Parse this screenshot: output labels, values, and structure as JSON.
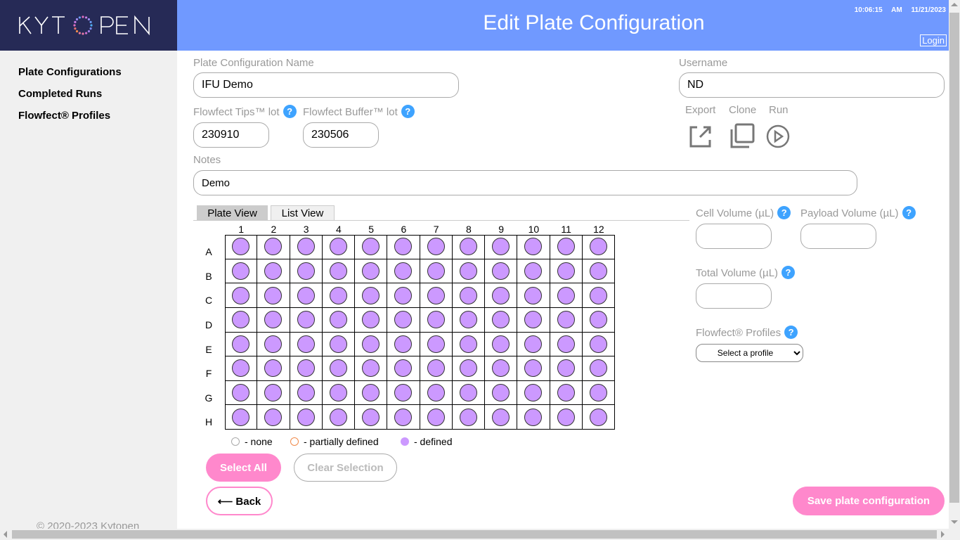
{
  "logo": {
    "text": "KYTOPEN"
  },
  "header": {
    "title": "Edit Plate Configuration",
    "time": "10:06:15 AM",
    "date": "11/21/2023",
    "login": "Login"
  },
  "sidebar": {
    "items": [
      {
        "label": "Plate Configurations"
      },
      {
        "label": "Completed Runs"
      },
      {
        "label": "Flowfect® Profiles"
      }
    ],
    "copyright": "© 2020-2023 Kytopen"
  },
  "form": {
    "name_label": "Plate Configuration Name",
    "name_value": "IFU Demo",
    "username_label": "Username",
    "username_value": "ND",
    "tips_label": "Flowfect Tips™ lot",
    "tips_value": "230910",
    "buffer_label": "Flowfect Buffer™ lot",
    "buffer_value": "230506",
    "notes_label": "Notes",
    "notes_value": "Demo",
    "help": "?"
  },
  "actions": {
    "export": "Export",
    "clone": "Clone",
    "run": "Run"
  },
  "tabs": [
    {
      "label": "Plate View",
      "active": true
    },
    {
      "label": "List View",
      "active": false
    }
  ],
  "plate": {
    "columns": [
      "1",
      "2",
      "3",
      "4",
      "5",
      "6",
      "7",
      "8",
      "9",
      "10",
      "11",
      "12"
    ],
    "rows": [
      "A",
      "B",
      "C",
      "D",
      "E",
      "F",
      "G",
      "H"
    ],
    "well_state": "defined",
    "defined_color": "#cc99ff"
  },
  "legend": [
    {
      "label": "- none",
      "color": "#ffffff",
      "border": "#aaaaaa"
    },
    {
      "label": "- partially defined",
      "color": "#ffffff",
      "border": "#f08a4b"
    },
    {
      "label": "- defined",
      "color": "#cc99ff",
      "border": "#cc99ff"
    }
  ],
  "volumes": {
    "cell_label": "Cell Volume (µL)",
    "cell_value": "",
    "payload_label": "Payload Volume (µL)",
    "payload_value": "",
    "total_label": "Total Volume (µL)",
    "total_value": "",
    "profiles_label": "Flowfect® Profiles",
    "profile_select": "Select a profile"
  },
  "buttons": {
    "select_all": "Select All",
    "clear_selection": "Clear Selection",
    "back": "⟵ Back",
    "save": "Save plate configuration"
  },
  "colors": {
    "header": "#7099ff",
    "logo_bg": "#262a56",
    "accent_pink": "#ff88cc",
    "help_blue": "#3ea3ff"
  }
}
